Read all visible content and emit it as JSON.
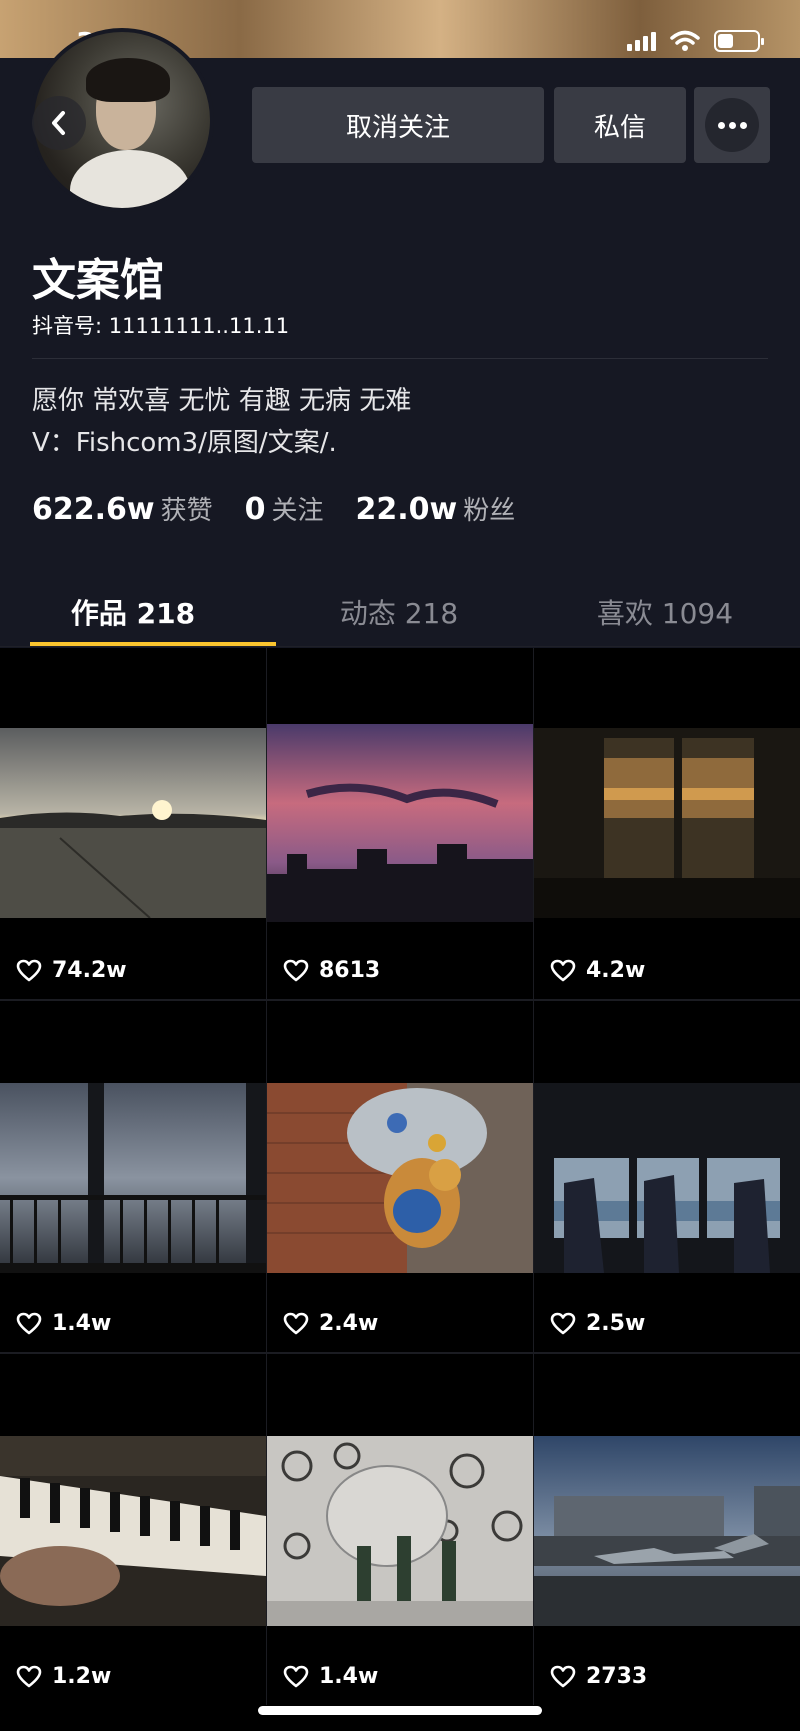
{
  "status_bar": {
    "time": "3:24",
    "battery_level": 0.4
  },
  "profile": {
    "name": "文案馆",
    "id_text": "抖音号: 11111111..11.11",
    "bio_lines": [
      "愿你 常欢喜 无忧  有趣 无病 无难",
      "V：Fishcom3/原图/文案/."
    ]
  },
  "actions": {
    "unfollow": "取消关注",
    "message": "私信"
  },
  "stats": [
    {
      "num": "622.6w",
      "label": "获赞"
    },
    {
      "num": "0",
      "label": "关注"
    },
    {
      "num": "22.0w",
      "label": "粉丝"
    }
  ],
  "tabs": [
    "作品 218",
    "动态 218",
    "喜欢 1094"
  ],
  "videos": [
    {
      "likes": "74.2w",
      "subject": "sunset over field"
    },
    {
      "likes": "8613",
      "subject": "pink sunset city skyline"
    },
    {
      "likes": "4.2w",
      "subject": "sunset through window"
    },
    {
      "likes": "1.4w",
      "subject": "cloudy sky behind railing"
    },
    {
      "likes": "2.4w",
      "subject": "teddy bear with trash bags"
    },
    {
      "likes": "2.5w",
      "subject": "bus seats by sea"
    },
    {
      "likes": "1.2w",
      "subject": "hands on piano"
    },
    {
      "likes": "1.4w",
      "subject": "bottles in circle-patterned room"
    },
    {
      "likes": "2733",
      "subject": "jets by palace building"
    }
  ]
}
